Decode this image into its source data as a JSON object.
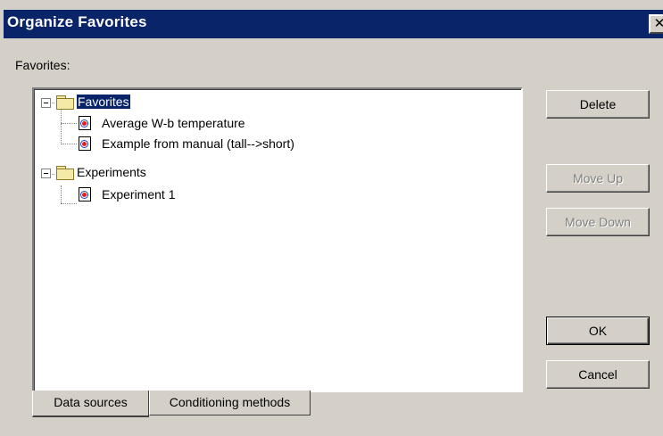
{
  "window": {
    "title": "Organize Favorites",
    "close_glyph": "✕"
  },
  "favorites_label": "Favorites:",
  "tree": {
    "nodes": [
      {
        "label": "Favorites",
        "type": "folder",
        "selected": true
      },
      {
        "label": "Average W-b temperature",
        "type": "document"
      },
      {
        "label": "Example from manual (tall-->short)",
        "type": "document"
      },
      {
        "label": "Experiments",
        "type": "folder"
      },
      {
        "label": "Experiment 1",
        "type": "document"
      }
    ]
  },
  "buttons": {
    "delete": "Delete",
    "move_up": "Move Up",
    "move_down": "Move Down",
    "ok": "OK",
    "cancel": "Cancel"
  },
  "tabs": [
    {
      "label": "Data sources",
      "active": true
    },
    {
      "label": "Conditioning methods",
      "active": false
    }
  ]
}
